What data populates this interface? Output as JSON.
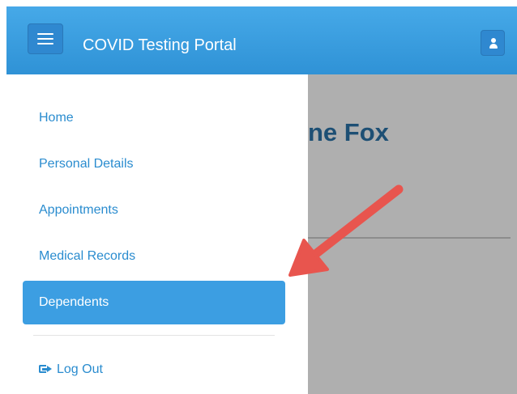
{
  "header": {
    "title": "COVID Testing Portal",
    "menu_icon": "hamburger-menu-icon",
    "user_icon": "user-icon",
    "color": "#3a9fe3"
  },
  "sidebar": {
    "items": [
      {
        "label": "Home"
      },
      {
        "label": "Personal Details"
      },
      {
        "label": "Appointments"
      },
      {
        "label": "Medical Records"
      },
      {
        "label": "Dependents",
        "active": true
      }
    ],
    "logout": {
      "label": "Log Out",
      "icon": "sign-out-icon"
    },
    "link_color": "#2a8ccf",
    "active_color": "#3c9ee2"
  },
  "content": {
    "heading_partial": "ne Fox"
  },
  "annotation": {
    "icon": "red-arrow",
    "color": "#e8554e"
  }
}
